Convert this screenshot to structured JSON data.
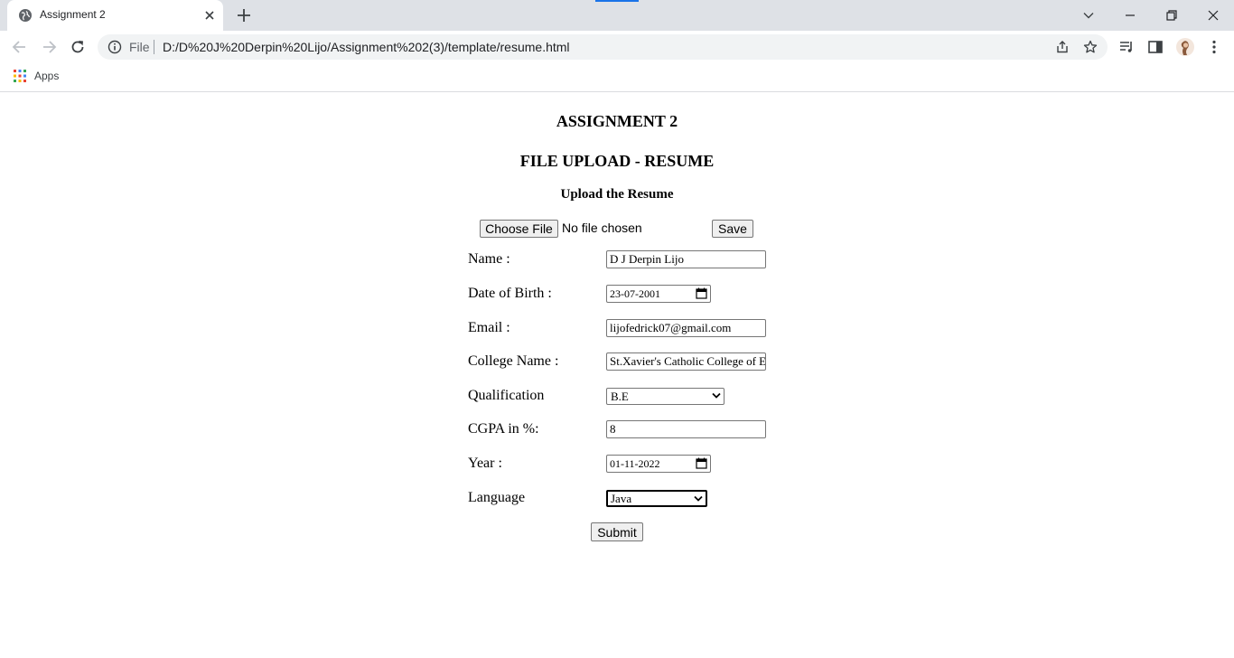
{
  "browser": {
    "tab_title": "Assignment 2",
    "omnibox_scheme": "File",
    "url": "D:/D%20J%20Derpin%20Lijo/Assignment%202(3)/template/resume.html",
    "bookmarks": {
      "apps_label": "Apps"
    }
  },
  "page": {
    "heading1": "ASSIGNMENT 2",
    "heading2": "FILE UPLOAD - RESUME",
    "heading3": "Upload the Resume",
    "upload": {
      "choose_file_label": "Choose File",
      "file_status": "No file chosen",
      "save_label": "Save"
    },
    "form": {
      "name_label": "Name :",
      "name_value": "D J Derpin Lijo",
      "dob_label": "Date of Birth :",
      "dob_value": "23-07-2001",
      "email_label": "Email :",
      "email_value": "lijofedrick07@gmail.com",
      "college_label": "College Name :",
      "college_value": "St.Xavier's Catholic College of Engineering",
      "qualification_label": "Qualification",
      "qualification_value": "B.E",
      "cgpa_label": "CGPA in %:",
      "cgpa_value": "8",
      "year_label": "Year :",
      "year_value": "01-11-2022",
      "language_label": "Language",
      "language_value": "Java",
      "submit_label": "Submit"
    }
  },
  "colors": {
    "tabstrip_bg": "#dee1e6",
    "omnibox_bg": "#f1f3f4",
    "accent": "#1a73e8",
    "button_bg": "#efefef",
    "field_border": "#767676"
  }
}
